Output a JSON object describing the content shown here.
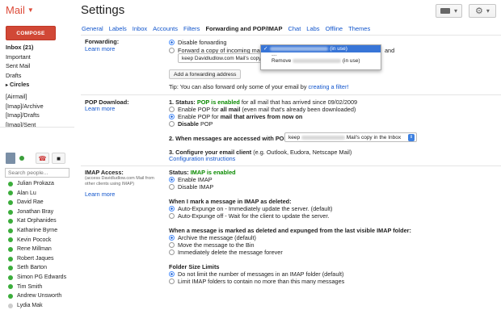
{
  "app": {
    "logo": "Mail",
    "title": "Settings"
  },
  "left": {
    "compose": "COMPOSE",
    "nav": [
      "Inbox (21)",
      "Important",
      "Sent Mail",
      "Drafts",
      "Circles",
      "[Airmail]",
      "[Imap]/Archive",
      "[Imap]/Drafts",
      "[Imap]/Sent"
    ],
    "search_placeholder": "Search people...",
    "contacts": [
      "Julian Prokaza",
      "Alan Lu",
      "David Rae",
      "Jonathan Bray",
      "Kat Orphanides",
      "Katharine Byrne",
      "Kevin Pocock",
      "Rene Millman",
      "Robert Jaques",
      "Seth Barton",
      "Simon PG Edwards",
      "Tim Smith",
      "Andrew Unsworth",
      "Lydia Mak"
    ]
  },
  "tabs": [
    "General",
    "Labels",
    "Inbox",
    "Accounts",
    "Filters",
    "Forwarding and POP/IMAP",
    "Chat",
    "Labs",
    "Offline",
    "Themes"
  ],
  "forwarding": {
    "label": "Forwarding:",
    "learn": "Learn more",
    "disable": "Disable forwarding",
    "forward_prefix": "Forward a copy of incoming mail to",
    "and": "and",
    "keep_select": "keep Davidludlow.com Mail's copy",
    "add_btn": "Add a forwarding address",
    "tip_prefix": "Tip: You can also forward only some of your email by",
    "tip_link": "creating a filter!",
    "dropdown": {
      "in_use": "(in use)",
      "sep": "---",
      "remove": "Remove"
    }
  },
  "pop": {
    "label": "POP Download:",
    "learn": "Learn more",
    "status_prefix": "1. Status:",
    "status": "POP is enabled",
    "status_suffix": "for all mail that has arrived since 09/02/2009",
    "opt1_a": "Enable POP for",
    "opt1_b": "all mail",
    "opt1_c": "(even mail that's already been downloaded)",
    "opt2_a": "Enable POP for",
    "opt2_b": "mail that arrives from now on",
    "opt3_a": "Disable",
    "opt3_b": "POP",
    "q2": "2. When messages are accessed with POP",
    "q2_select_a": "keep",
    "q2_select_b": "Mail's copy in the Inbox",
    "q3_a": "3. Configure your email client",
    "q3_b": "(e.g. Outlook, Eudora, Netscape Mail)",
    "config_link": "Configuration instructions"
  },
  "imap": {
    "label": "IMAP Access:",
    "note": "(access Davidludlow.com Mail from other clients using IMAP)",
    "learn": "Learn more",
    "status_prefix": "Status:",
    "status": "IMAP is enabled",
    "enable": "Enable IMAP",
    "disable": "Disable IMAP",
    "deleted_q": "When I mark a message in IMAP as deleted:",
    "auto_on": "Auto-Expunge on - Immediately update the server. (default)",
    "auto_off": "Auto-Expunge off - Wait for the client to update the server.",
    "expunged_q": "When a message is marked as deleted and expunged from the last visible IMAP folder:",
    "archive": "Archive the message (default)",
    "bin": "Move the message to the Bin",
    "delete_forever": "Immediately delete the message forever",
    "folder_title": "Folder Size Limits",
    "no_limit": "Do not limit the number of messages in an IMAP folder (default)",
    "limit": "Limit IMAP folders to contain no more than this many messages"
  }
}
